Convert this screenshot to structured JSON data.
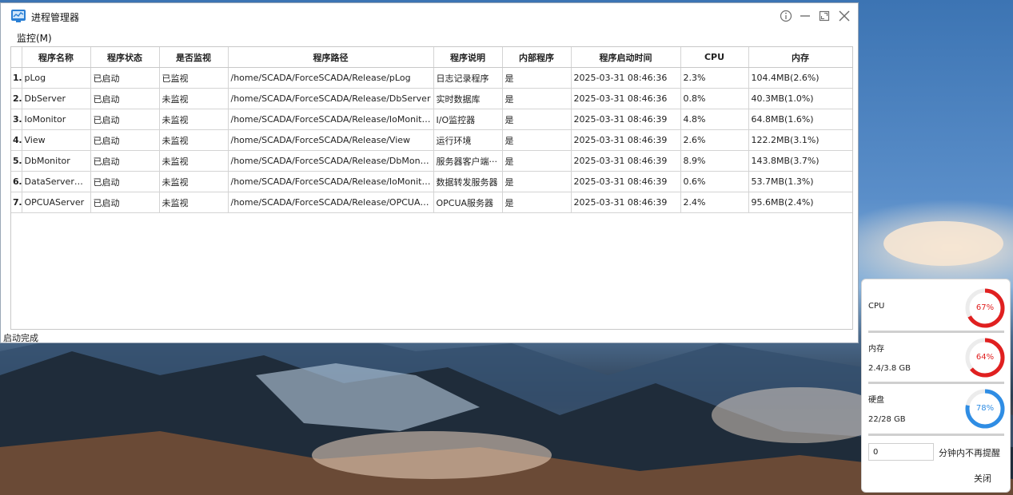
{
  "window": {
    "title": "进程管理器",
    "menu": [
      "监控(M)"
    ],
    "status": "启动完成"
  },
  "table": {
    "columns": [
      "",
      "程序名称",
      "程序状态",
      "是否监视",
      "程序路径",
      "程序说明",
      "内部程序",
      "程序启动时间",
      "CPU",
      "内存"
    ],
    "rows": [
      [
        "1",
        "pLog",
        "已启动",
        "已监视",
        "/home/SCADA/ForceSCADA/Release/pLog",
        "日志记录程序",
        "是",
        "2025-03-31 08:46:36",
        "2.3%",
        "104.4MB(2.6%)"
      ],
      [
        "2",
        "DbServer",
        "已启动",
        "未监视",
        "/home/SCADA/ForceSCADA/Release/DbServer",
        "实时数据库",
        "是",
        "2025-03-31 08:46:36",
        "0.8%",
        "40.3MB(1.0%)"
      ],
      [
        "3",
        "IoMonitor",
        "已启动",
        "未监视",
        "/home/SCADA/ForceSCADA/Release/IoMonitor/···",
        "I/O监控器",
        "是",
        "2025-03-31 08:46:39",
        "4.8%",
        "64.8MB(1.6%)"
      ],
      [
        "4",
        "View",
        "已启动",
        "未监视",
        "/home/SCADA/ForceSCADA/Release/View",
        "运行环境",
        "是",
        "2025-03-31 08:46:39",
        "2.6%",
        "122.2MB(3.1%)"
      ],
      [
        "5",
        "DbMonitor",
        "已启动",
        "未监视",
        "/home/SCADA/ForceSCADA/Release/DbMonitor",
        "服务器客户端···",
        "是",
        "2025-03-31 08:46:39",
        "8.9%",
        "143.8MB(3.7%)"
      ],
      [
        "6",
        "DataServerMa···",
        "已启动",
        "未监视",
        "/home/SCADA/ForceSCADA/Release/IoMonitor/···",
        "数据转发服务器",
        "是",
        "2025-03-31 08:46:39",
        "0.6%",
        "53.7MB(1.3%)"
      ],
      [
        "7",
        "OPCUAServer",
        "已启动",
        "未监视",
        "/home/SCADA/ForceSCADA/Release/OPCUAServer···",
        "OPCUA服务器",
        "是",
        "2025-03-31 08:46:39",
        "2.4%",
        "95.6MB(2.4%)"
      ]
    ]
  },
  "monitor": {
    "cpu": {
      "label": "CPU",
      "percent": 67,
      "text": "67%",
      "color": "#e02020"
    },
    "memory": {
      "label": "内存",
      "sub": "2.4/3.8 GB",
      "percent": 64,
      "text": "64%",
      "color": "#e02020"
    },
    "disk": {
      "label": "硬盘",
      "sub": "22/28 GB",
      "percent": 78,
      "text": "78%",
      "color": "#2f8de4"
    },
    "minutes_value": "0",
    "minutes_label": "分钟内不再提醒",
    "close_label": "关闭"
  }
}
